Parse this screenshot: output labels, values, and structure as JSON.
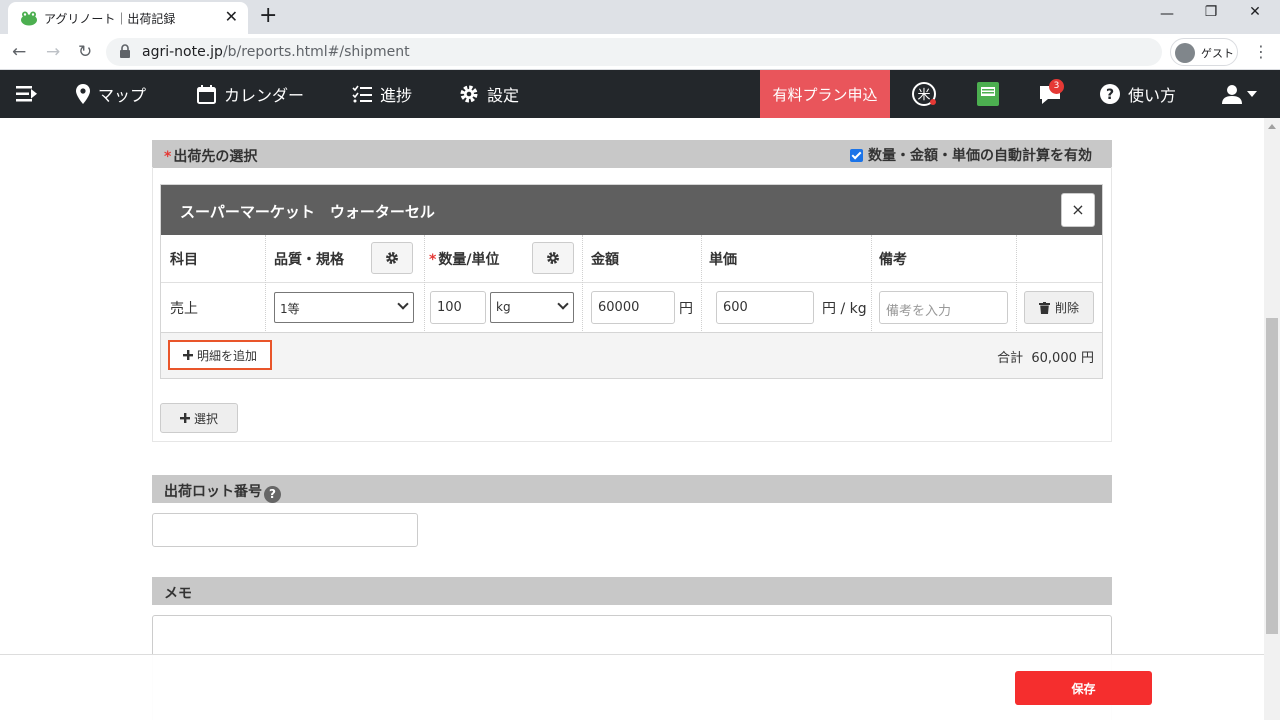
{
  "browser": {
    "tab_title": "アグリノート｜出荷記録",
    "tab_close": "✕",
    "new_tab": "+",
    "url_host": "agri-note.jp",
    "url_path": "/b/reports.html#/shipment",
    "profile_label": "ゲスト"
  },
  "nav": {
    "map": "マップ",
    "calendar": "カレンダー",
    "progress": "進捗",
    "settings": "設定",
    "paid_plan": "有料プラン申込",
    "notifications_count": "3",
    "help": "使い方"
  },
  "shipment": {
    "section_title": "出荷先の選択",
    "required_mark": "*",
    "auto_calc_label": "数量・金額・単価の自動計算を有効",
    "auto_calc_checked": true,
    "customer_name": "スーパーマーケット　ウォーターセル",
    "close": "×",
    "columns": {
      "item": "科目",
      "quality": "品質・規格",
      "qty_unit": "数量/単位",
      "amount": "金額",
      "unit_price": "単価",
      "note": "備考"
    },
    "row": {
      "item": "売上",
      "quality": "1等",
      "qty": "100",
      "unit": "kg",
      "amount": "60000",
      "amount_unit": "円",
      "unit_price": "600",
      "unit_price_unit": "円 / kg",
      "note_placeholder": "備考を入力",
      "delete": "削除"
    },
    "add_detail": "明細を追加",
    "total_label": "合計",
    "total_value": "60,000 円",
    "select_button": "選択"
  },
  "lot": {
    "title": "出荷ロット番号",
    "help": "?"
  },
  "memo": {
    "title": "メモ"
  },
  "save_button": "保存",
  "colors": {
    "header_bg": "#23272b",
    "paid_plan_bg": "#e9555b",
    "save_bg": "#f52e2e",
    "highlight": "#e9552a"
  }
}
